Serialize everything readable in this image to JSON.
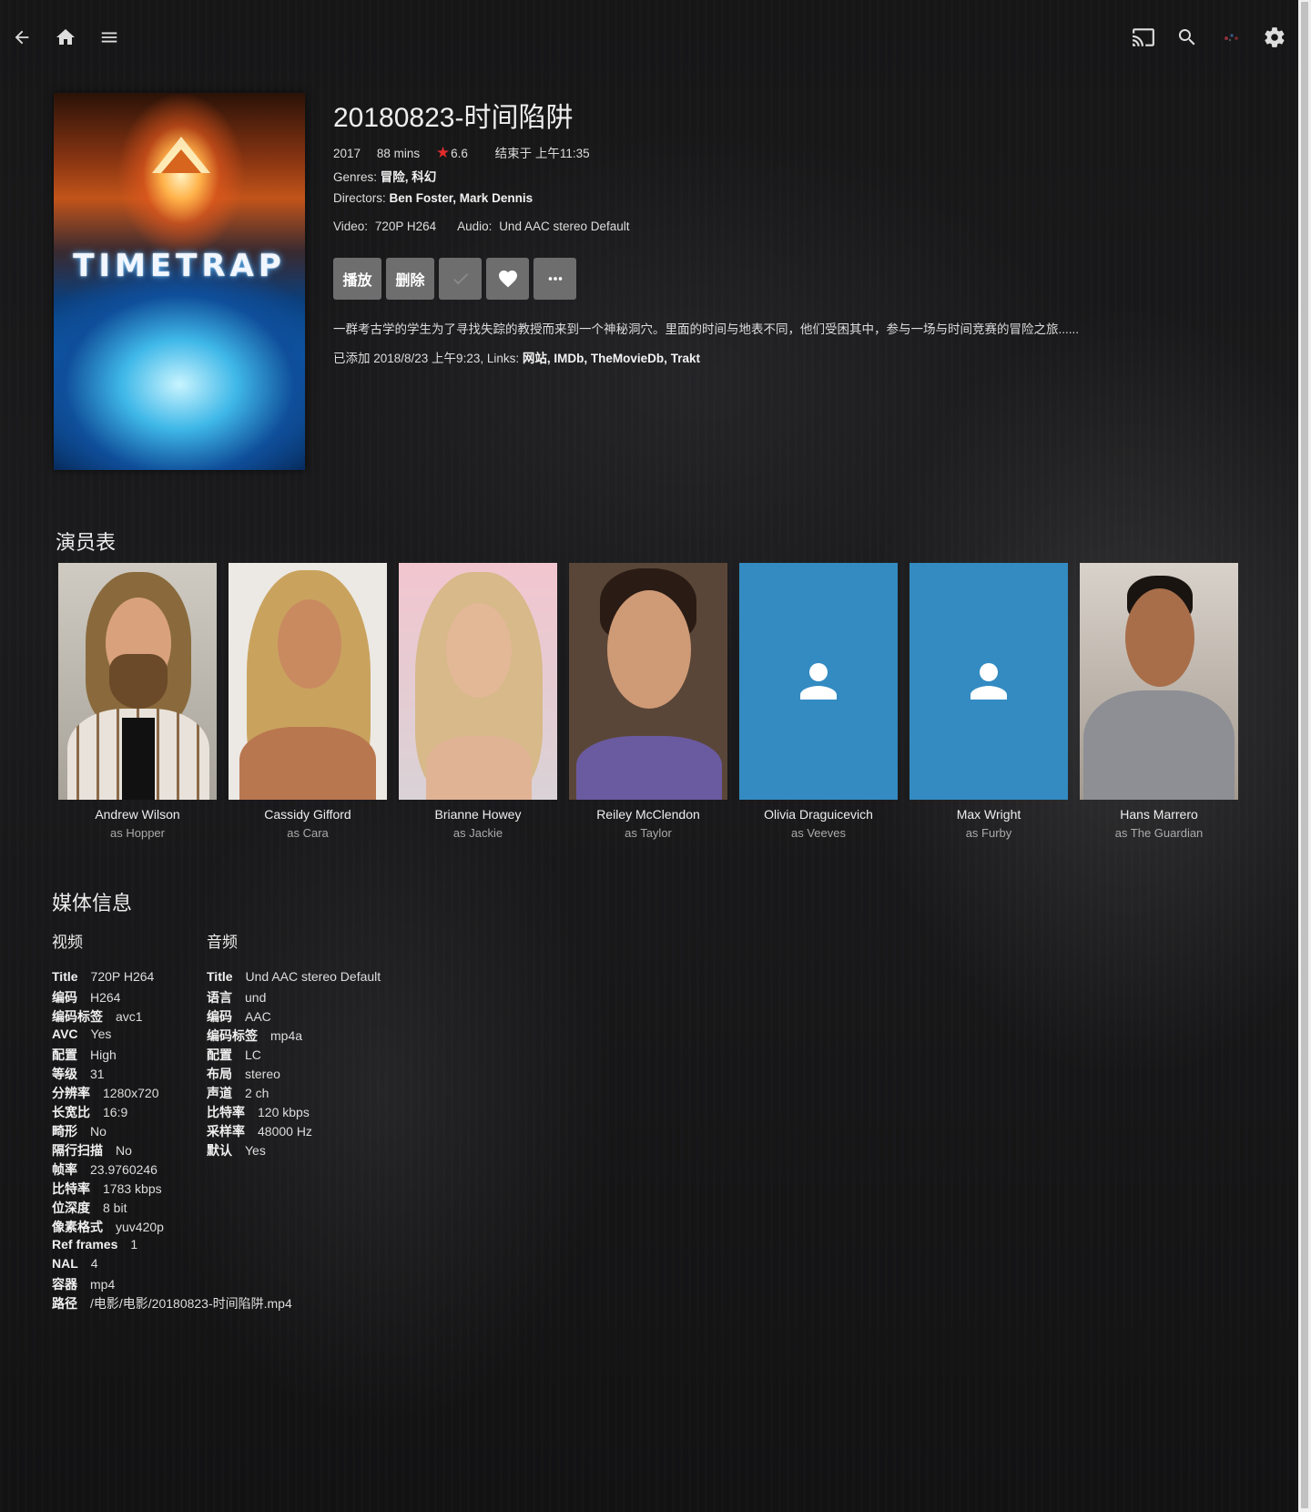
{
  "item": {
    "title": "20180823-时间陷阱",
    "year": "2017",
    "runtime": "88 mins",
    "rating": "6.6",
    "ends_at": "结束于 上午11:35",
    "genres_label": "Genres:",
    "genres": "冒险, 科幻",
    "directors_label": "Directors:",
    "directors": "Ben Foster, Mark Dennis",
    "video_label": "Video:",
    "video": "720P H264",
    "audio_label": "Audio:",
    "audio": "Und AAC stereo Default",
    "overview": "一群考古学的学生为了寻找失踪的教授而来到一个神秘洞穴。里面的时间与地表不同，他们受困其中，参与一场与时间竞赛的冒险之旅......",
    "added": "已添加 2018/8/23 上午9:23, Links:",
    "links": [
      "网站",
      "IMDb",
      "TheMovieDb",
      "Trakt"
    ],
    "poster_title": "TIMETRAP"
  },
  "buttons": {
    "play": "播放",
    "delete": "删除"
  },
  "icons": {
    "back": "arrow-back-icon",
    "home": "home-icon",
    "menu": "hamburger-menu-icon",
    "cast": "cast-icon",
    "search": "search-icon",
    "user": "user-avatar-icon",
    "settings": "gear-icon",
    "played": "check-icon",
    "favorite": "heart-icon",
    "more": "more-dots-icon"
  },
  "colors": {
    "star": "#e22b2b",
    "placeholder": "#338bc2",
    "button": "#6e6e6e"
  },
  "cast_section": {
    "title": "演员表",
    "people": [
      {
        "name": "Andrew Wilson",
        "role": "as Hopper"
      },
      {
        "name": "Cassidy Gifford",
        "role": "as Cara"
      },
      {
        "name": "Brianne Howey",
        "role": "as Jackie"
      },
      {
        "name": "Reiley McClendon",
        "role": "as Taylor"
      },
      {
        "name": "Olivia Draguicevich",
        "role": "as Veeves"
      },
      {
        "name": "Max Wright",
        "role": "as Furby"
      },
      {
        "name": "Hans Marrero",
        "role": "as The Guardian"
      }
    ]
  },
  "media_info": {
    "title": "媒体信息",
    "video": {
      "heading": "视频",
      "rows": [
        {
          "k": "Title",
          "v": "720P H264"
        },
        {
          "k": "编码",
          "v": "H264"
        },
        {
          "k": "编码标签",
          "v": "avc1"
        },
        {
          "k": "AVC",
          "v": "Yes"
        },
        {
          "k": "配置",
          "v": "High"
        },
        {
          "k": "等级",
          "v": "31"
        },
        {
          "k": "分辨率",
          "v": "1280x720"
        },
        {
          "k": "长宽比",
          "v": "16:9"
        },
        {
          "k": "畸形",
          "v": "No"
        },
        {
          "k": "隔行扫描",
          "v": "No"
        },
        {
          "k": "帧率",
          "v": "23.9760246"
        },
        {
          "k": "比特率",
          "v": "1783 kbps"
        },
        {
          "k": "位深度",
          "v": "8 bit"
        },
        {
          "k": "像素格式",
          "v": "yuv420p"
        },
        {
          "k": "Ref frames",
          "v": "1"
        },
        {
          "k": "NAL",
          "v": "4"
        },
        {
          "k": "容器",
          "v": "mp4"
        },
        {
          "k": "路径",
          "v": "/电影/电影/20180823-时间陷阱.mp4"
        }
      ]
    },
    "audio": {
      "heading": "音频",
      "rows": [
        {
          "k": "Title",
          "v": "Und AAC stereo Default"
        },
        {
          "k": "语言",
          "v": "und"
        },
        {
          "k": "编码",
          "v": "AAC"
        },
        {
          "k": "编码标签",
          "v": "mp4a"
        },
        {
          "k": "配置",
          "v": "LC"
        },
        {
          "k": "布局",
          "v": "stereo"
        },
        {
          "k": "声道",
          "v": "2 ch"
        },
        {
          "k": "比特率",
          "v": "120 kbps"
        },
        {
          "k": "采样率",
          "v": "48000 Hz"
        },
        {
          "k": "默认",
          "v": "Yes"
        }
      ]
    }
  }
}
